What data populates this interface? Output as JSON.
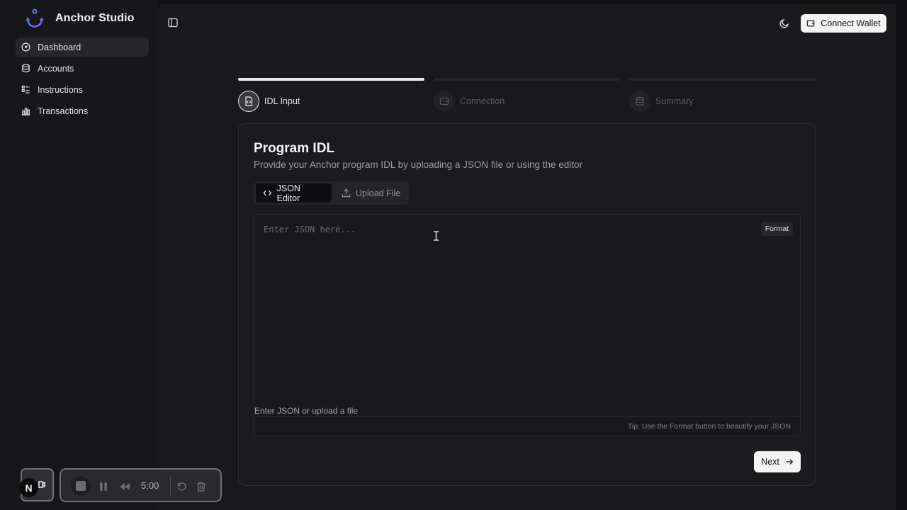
{
  "app": {
    "name": "Anchor Studio",
    "logo_icon": "anchor-logo",
    "accent_color": "#4f6ef7"
  },
  "sidebar": {
    "items": [
      {
        "label": "Dashboard",
        "icon": "gauge-icon",
        "active": true
      },
      {
        "label": "Accounts",
        "icon": "database-icon",
        "active": false
      },
      {
        "label": "Instructions",
        "icon": "list-icon",
        "active": false
      },
      {
        "label": "Transactions",
        "icon": "bar-chart-icon",
        "active": false
      }
    ]
  },
  "header": {
    "theme_icon": "moon-icon",
    "connect_wallet_label": "Connect Wallet",
    "connect_wallet_icon": "wallet-icon"
  },
  "stepper": {
    "steps": [
      {
        "label": "IDL Input",
        "icon": "file-code-icon",
        "state": "current"
      },
      {
        "label": "Connection",
        "icon": "wallet-icon",
        "state": "upcoming"
      },
      {
        "label": "Summary",
        "icon": "database-icon",
        "state": "upcoming"
      }
    ]
  },
  "card": {
    "title": "Program IDL",
    "description": "Provide your Anchor program IDL by uploading a JSON file or using the editor",
    "tabs": [
      {
        "label": "JSON Editor",
        "icon": "code-icon",
        "active": true
      },
      {
        "label": "Upload File",
        "icon": "upload-icon",
        "active": false
      }
    ],
    "editor": {
      "value": "",
      "placeholder": "Enter JSON here...",
      "format_label": "Format",
      "helper_text": "Enter JSON or upload a file",
      "tip": "Tip: Use the Format button to beautify your JSON"
    },
    "next_label": "Next"
  },
  "recorder": {
    "badge": "N",
    "time": "5:00"
  }
}
